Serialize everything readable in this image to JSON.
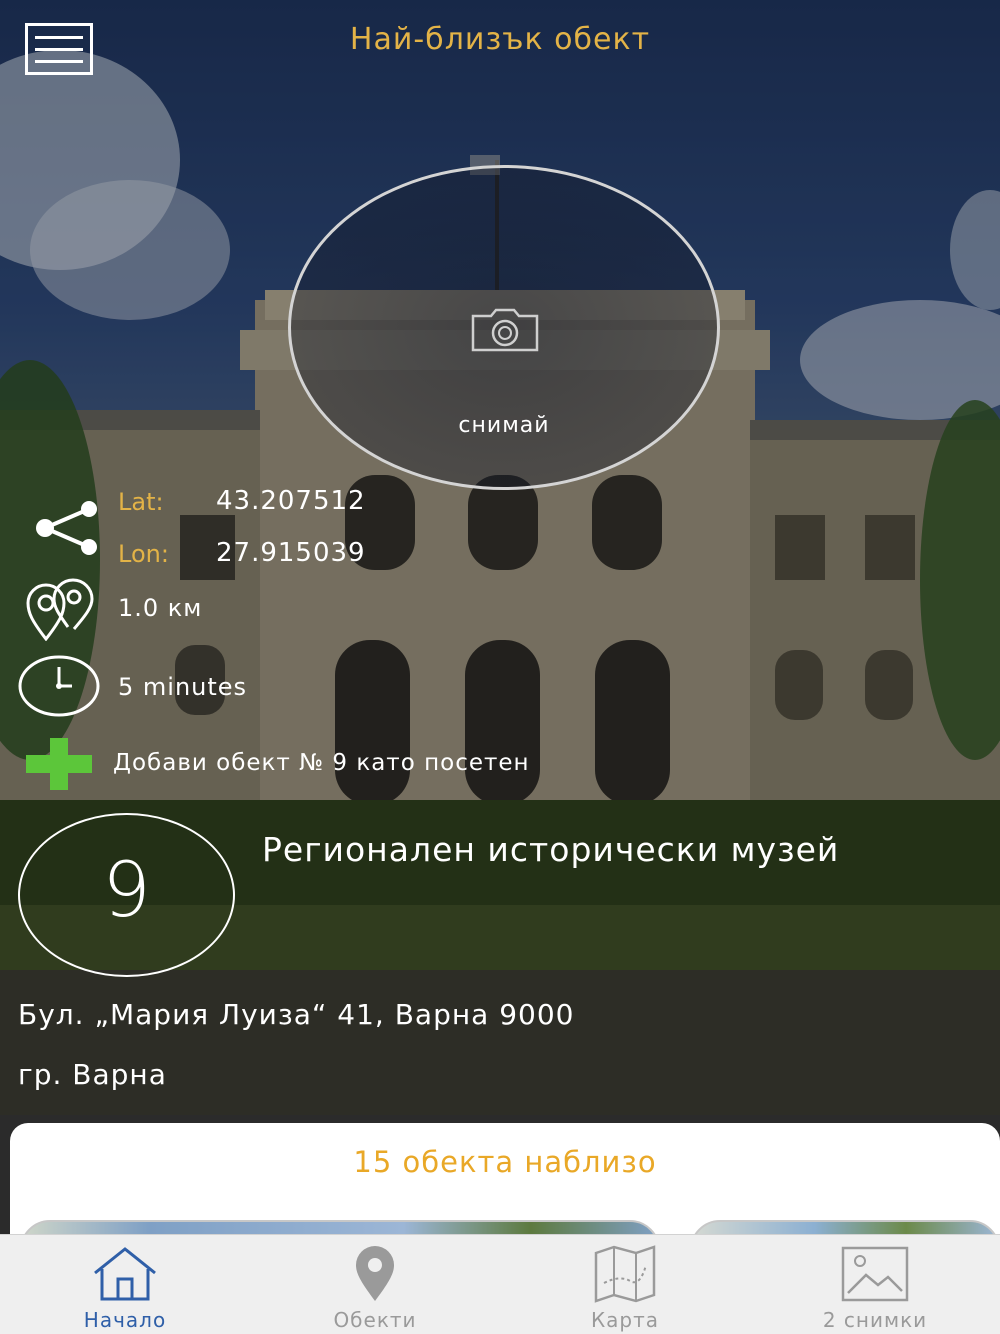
{
  "header": {
    "menu_icon": "hamburger-menu-icon",
    "title": "Най-близък обект"
  },
  "camera": {
    "icon": "camera-icon",
    "label": "снимай"
  },
  "location": {
    "share_icon": "share-icon",
    "lat_label": "Lat:",
    "lat_value": "43.207512",
    "lon_label": "Lon:",
    "lon_value": "27.915039",
    "distance_icon": "map-pins-icon",
    "distance": "1.0 км",
    "time_icon": "clock-icon",
    "duration": "5 minutes"
  },
  "add_visited": {
    "icon": "plus-icon",
    "label": "Добави обект № 9 като посетен"
  },
  "site": {
    "number": "9",
    "name": "Регионален исторически музей",
    "address": "Бул. „Мария Луиза“ 41, Варна 9000",
    "city": "гр. Варна"
  },
  "nearby": {
    "title": "15 обекта наблизо"
  },
  "tabbar": {
    "tabs": [
      {
        "label": "Начало",
        "icon": "home-icon",
        "active": true
      },
      {
        "label": "Обекти",
        "icon": "location-pin-icon",
        "active": false
      },
      {
        "label": "Карта",
        "icon": "map-icon",
        "active": false
      },
      {
        "label": "2 снимки",
        "icon": "image-icon",
        "active": false
      }
    ]
  },
  "colors": {
    "accent_gold": "#e3b347",
    "nearby_title": "#e9a827",
    "active_tab": "#2f5fa8",
    "inactive_tab": "#9a9a9a",
    "plus_green": "#5cc63a"
  }
}
